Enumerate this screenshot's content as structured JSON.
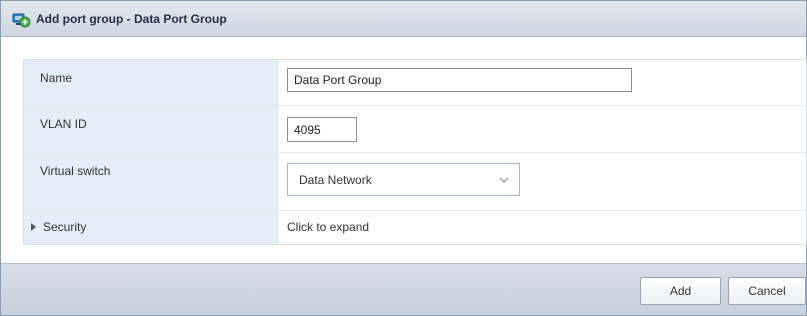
{
  "dialog": {
    "title": "Add port group - Data Port Group",
    "icon": "network-port-group-icon"
  },
  "form": {
    "name": {
      "label": "Name",
      "value": "Data Port Group"
    },
    "vlan": {
      "label": "VLAN ID",
      "value": "4095"
    },
    "virtual_switch": {
      "label": "Virtual switch",
      "selected": "Data Network"
    },
    "security": {
      "label": "Security",
      "value": "Click to expand"
    }
  },
  "buttons": {
    "add": "Add",
    "cancel": "Cancel"
  },
  "colors": {
    "label_bg": "#e4eef7",
    "titlebar": "#d6dde6",
    "select_border": "#9db7e3"
  }
}
